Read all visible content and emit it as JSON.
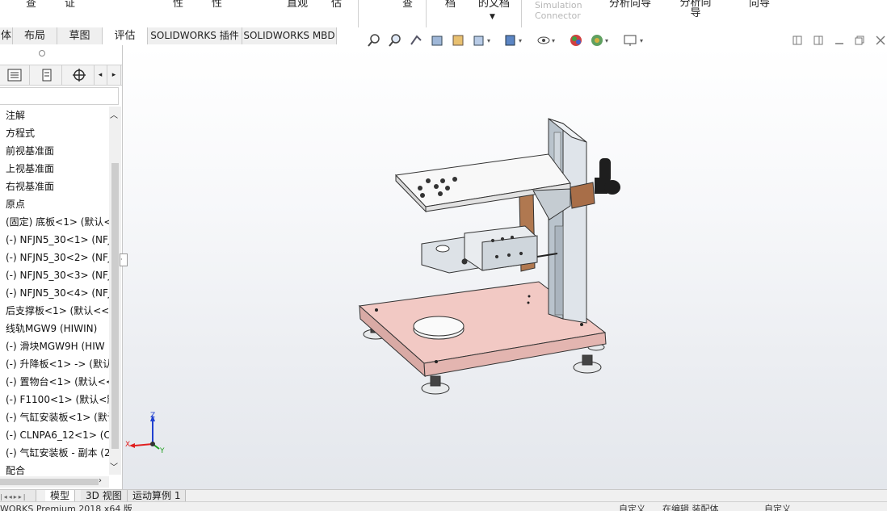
{
  "ribbon": {
    "items": [
      "查",
      "证",
      "性",
      "性",
      "直观",
      "估",
      "查",
      "档",
      "的文档",
      "分析向导",
      "分析向导",
      "向导"
    ],
    "simulation_connector": "Simulation Connector"
  },
  "cmd_tabs": [
    "体",
    "布局",
    "草图",
    "评估",
    "SOLIDWORKS 插件",
    "SOLIDWORKS MBD"
  ],
  "window_controls": [
    "restore-icon",
    "restore-icon",
    "minimize-icon",
    "maximize-icon",
    "close-icon"
  ],
  "tree": {
    "items": [
      "注解",
      "方程式",
      "前视基准面",
      "上视基准面",
      "右视基准面",
      "原点",
      "(固定) 底板<1> (默认<",
      "(-) NFJN5_30<1> (NFJ",
      "(-) NFJN5_30<2> (NFJ",
      "(-) NFJN5_30<3> (NFJ",
      "(-) NFJN5_30<4> (NFJ",
      "后支撑板<1> (默认<<默",
      "线轨MGW9 (HIWIN)",
      "(-) 滑块MGW9H (HIW",
      "(-) 升降板<1> -> (默认",
      "(-) 置物台<1> (默认<<",
      "(-) F1100<1> (默认<默",
      "(-) 气缸安装板<1> (默认",
      "(-) CLNPA6_12<1> (CL",
      "(-) 气缸安装板 - 副本 (2",
      "配合"
    ]
  },
  "triad": {
    "x": "X",
    "y": "Y",
    "z": "Z"
  },
  "bottom_tabs": [
    "模型",
    "3D 视图",
    "运动算例 1"
  ],
  "status": {
    "left": "WORKS Premium 2018 x64 版",
    "mid1": "自定义",
    "mid2": "在编辑 装配体",
    "right": "自定义"
  },
  "colors": {
    "base_plate": "#f2c9c4",
    "accent_bracket": "#b07850",
    "triad_x": "#e02020",
    "triad_y": "#20a020",
    "triad_z": "#2040d0"
  }
}
